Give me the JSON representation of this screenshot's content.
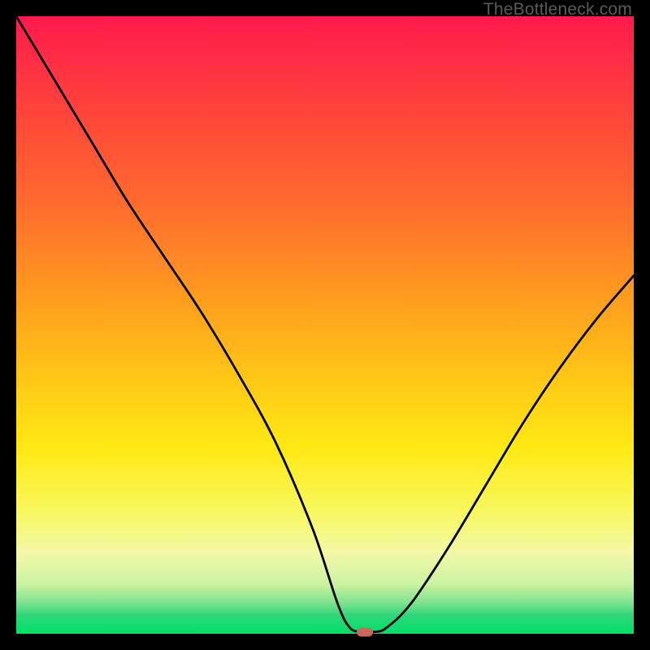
{
  "attribution": "TheBottleneck.com",
  "colors": {
    "frame": "#000000",
    "gradient_top": "#ff1a4d",
    "gradient_bottom": "#00e066",
    "curve": "#000000",
    "marker": "#c76a5d"
  },
  "chart_data": {
    "type": "line",
    "title": "",
    "xlabel": "",
    "ylabel": "",
    "xlim": [
      0,
      100
    ],
    "ylim": [
      0,
      100
    ],
    "annotations": [],
    "series": [
      {
        "name": "bottleneck-curve",
        "x": [
          0,
          6,
          12,
          18,
          24,
          30,
          36,
          42,
          48,
          52,
          54,
          56,
          58,
          60,
          64,
          70,
          76,
          82,
          88,
          94,
          100
        ],
        "values": [
          100,
          90,
          80,
          70,
          61,
          52,
          42,
          31,
          17,
          5,
          1,
          0.3,
          0.3,
          1,
          5,
          14,
          24,
          34,
          43,
          51,
          58
        ]
      }
    ],
    "marker": {
      "x": 56.5,
      "y": 0.3
    }
  }
}
